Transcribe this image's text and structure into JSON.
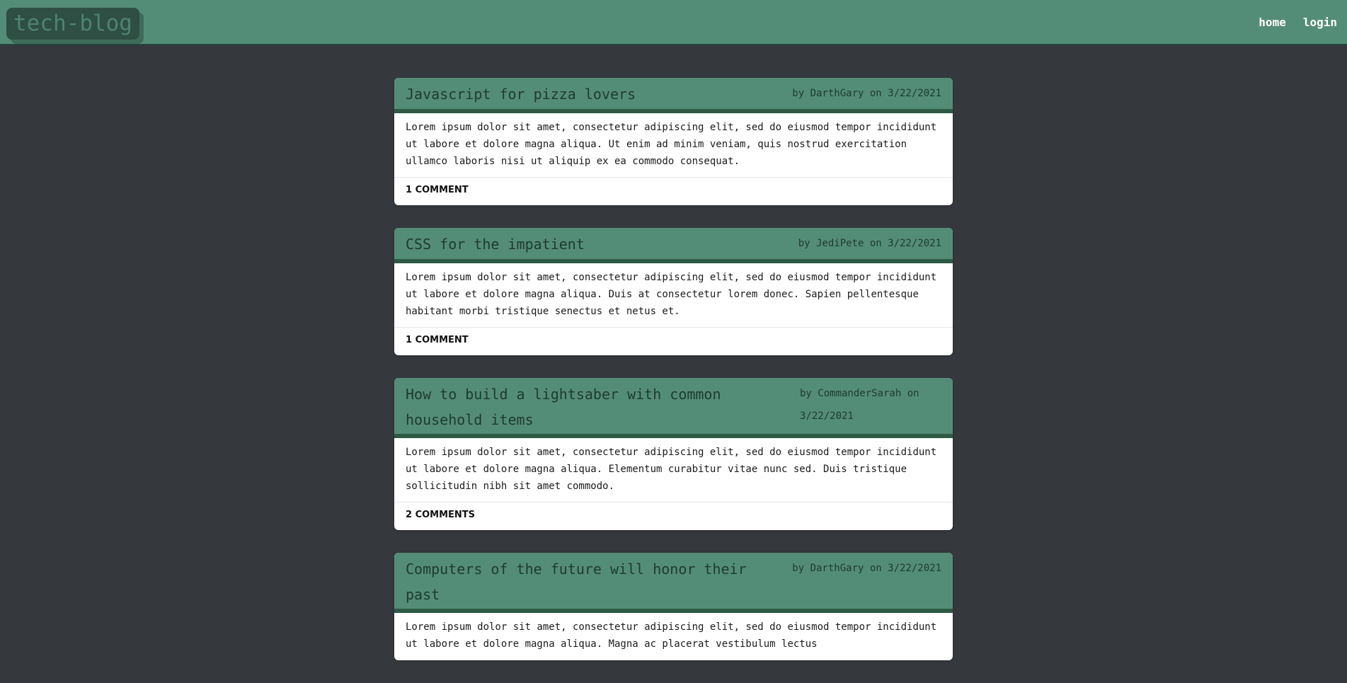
{
  "nav": {
    "brand": "tech-blog",
    "links": [
      "home",
      "login"
    ]
  },
  "posts": [
    {
      "title": "Javascript for pizza lovers",
      "meta": "by DarthGary on 3/22/2021",
      "body": "Lorem ipsum dolor sit amet, consectetur adipiscing elit, sed do eiusmod tempor incididunt ut labore et dolore magna aliqua. Ut enim ad minim veniam, quis nostrud exercitation ullamco laboris nisi ut aliquip ex ea commodo consequat.",
      "comments": "1 COMMENT"
    },
    {
      "title": "CSS for the impatient",
      "meta": "by JediPete on 3/22/2021",
      "body": "Lorem ipsum dolor sit amet, consectetur adipiscing elit, sed do eiusmod tempor incididunt ut labore et dolore magna aliqua. Duis at consectetur lorem donec. Sapien pellentesque habitant morbi tristique senectus et netus et.",
      "comments": "1 COMMENT"
    },
    {
      "title": "How to build a lightsaber with common household items",
      "meta": "by CommanderSarah on 3/22/2021",
      "body": "Lorem ipsum dolor sit amet, consectetur adipiscing elit, sed do eiusmod tempor incididunt ut labore et dolore magna aliqua. Elementum curabitur vitae nunc sed. Duis tristique sollicitudin nibh sit amet commodo.",
      "comments": "2 COMMENTS"
    },
    {
      "title": "Computers of the future will honor their past",
      "meta": "by DarthGary on 3/22/2021",
      "body": "Lorem ipsum dolor sit amet, consectetur adipiscing elit, sed do eiusmod tempor incididunt ut labore et dolore magna aliqua. Magna ac placerat vestibulum lectus",
      "comments": ""
    }
  ]
}
